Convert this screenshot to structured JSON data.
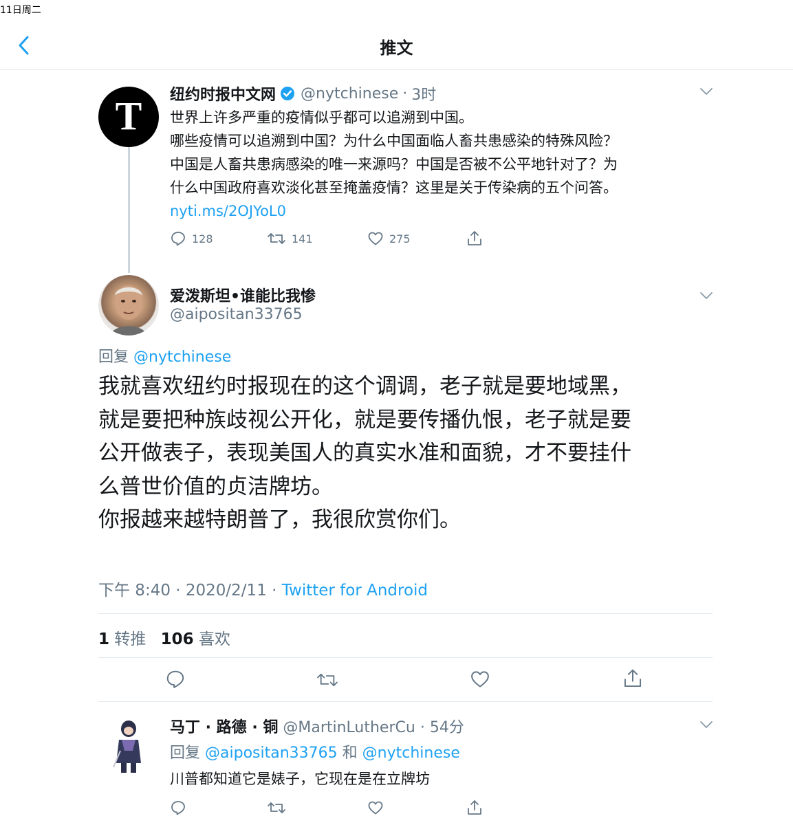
{
  "status_bar": {
    "text": "11日周二"
  },
  "header": {
    "title": "推文"
  },
  "parent_tweet": {
    "display_name": "纽约时报中文网",
    "handle": "@nytchinese",
    "sep": "·",
    "time": "3时",
    "avatar_letter": "T",
    "lines": [
      "世界上许多严重的疫情似乎都可以追溯到中国。",
      "哪些疫情可以追溯到中国？为什么中国面临人畜共患感染的特殊风险？",
      "中国是人畜共患病感染的唯一来源吗？中国是否被不公平地针对了？为",
      "什么中国政府喜欢淡化甚至掩盖疫情？这里是关于传染病的五个问答。"
    ],
    "link": "nyti.ms/2OJYoL0",
    "replies": "128",
    "retweets": "141",
    "likes": "275"
  },
  "main_tweet": {
    "display_name": "爱泼斯坦•谁能比我惨",
    "handle": "@aipositan33765",
    "reply_prefix": "回复",
    "reply_to": "@nytchinese",
    "lines": [
      "我就喜欢纽约时报现在的这个调调，老子就是要地域黑，",
      "就是要把种族歧视公开化，就是要传播仇恨，老子就是要",
      "公开做表子，表现美国人的真实水准和面貌，才不要挂什",
      "么普世价值的贞洁牌坊。",
      "你报越来越特朗普了，我很欣赏你们。"
    ],
    "meta": "下午 8:40 · 2020/2/11 · ",
    "source": "Twitter for Android",
    "retweet_count": "1",
    "retweet_label": "转推",
    "like_count": "106",
    "like_label": "喜欢"
  },
  "reply_tweet": {
    "display_name": "马丁 · 路德 · 铜",
    "handle": "@MartinLutherCu",
    "sep": "·",
    "time": "54分",
    "reply_prefix": "回复",
    "reply_to_1": "@aipositan33765",
    "reply_and": "和",
    "reply_to_2": "@nytchinese",
    "text": "川普都知道它是婊子，它现在是在立牌坊"
  },
  "colors": {
    "link": "#1da1f2",
    "muted": "#657786",
    "text": "#14171a",
    "divider": "#e1e8ed",
    "verified": "#1da1f2"
  },
  "icons": [
    "chevron-left-icon",
    "verified-badge-icon",
    "chevron-down-icon",
    "reply-icon",
    "retweet-icon",
    "like-icon",
    "share-icon"
  ]
}
